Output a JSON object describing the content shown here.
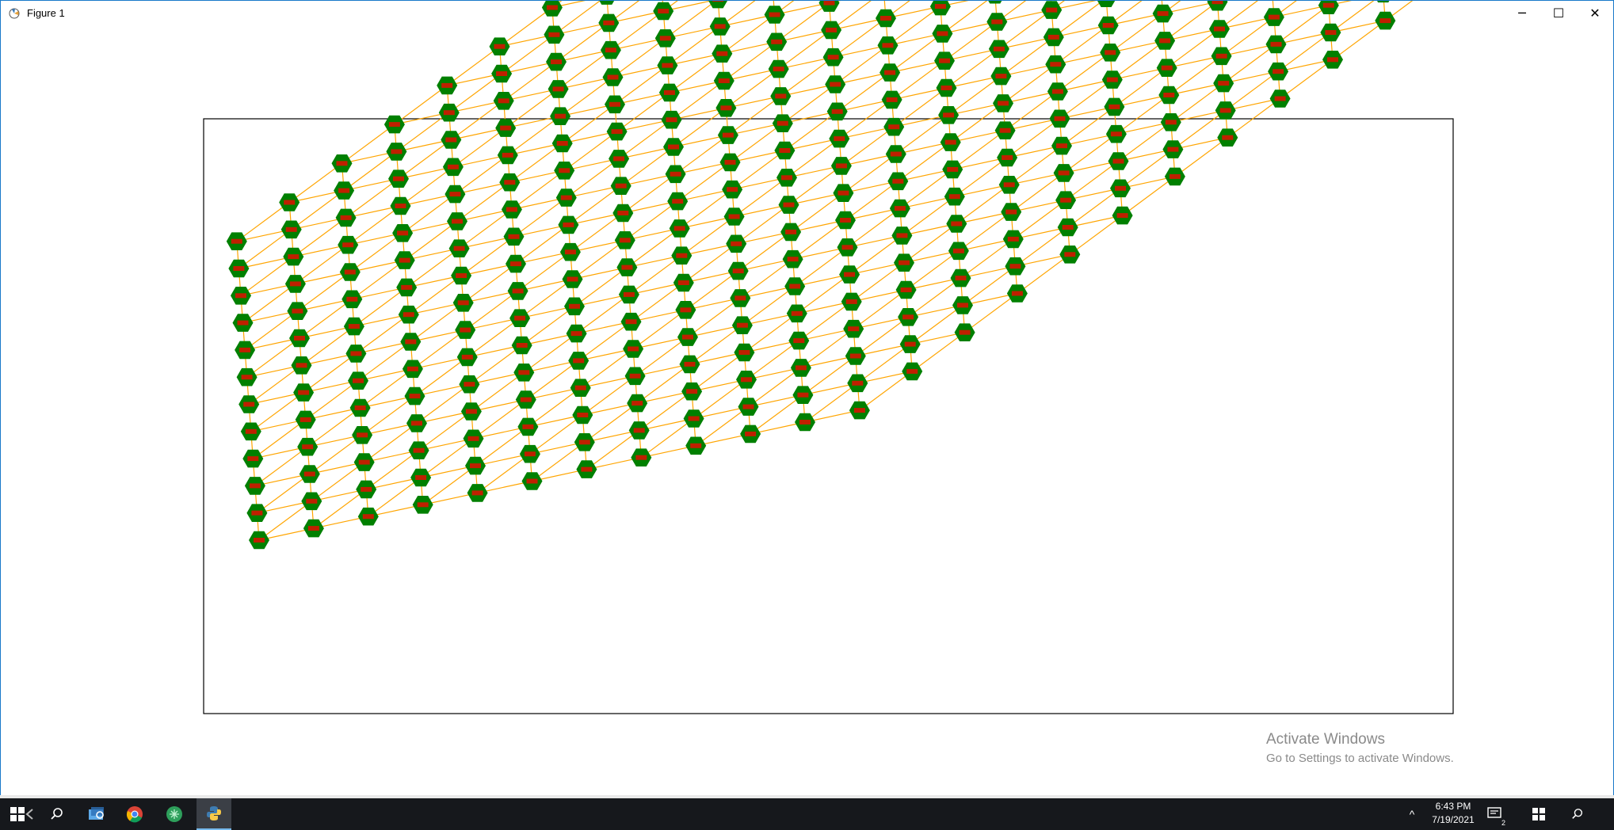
{
  "window": {
    "title": "Figure 1",
    "minimize_glyph": "─",
    "maximize_glyph": "☐",
    "close_glyph": "✕",
    "app_icon": "matplotlib-figure-icon"
  },
  "graph": {
    "node_color": "#008000",
    "label_color": "#ff0000",
    "edge_color": "#ffa500",
    "node_shape": "hexagon",
    "layout": "hexagonal lattice, 24 columns",
    "frame": "axes frame (no ticks)"
  },
  "watermark": {
    "title": "Activate Windows",
    "subtitle": "Go to Settings to activate Windows."
  },
  "taskbar": {
    "apps": [
      {
        "name": "start-button",
        "icon": "windows-logo-icon"
      },
      {
        "name": "back",
        "icon": "arrow-left-icon"
      },
      {
        "name": "search",
        "icon": "search-icon"
      },
      {
        "name": "task-view",
        "icon": "task-view-icon"
      },
      {
        "name": "chrome",
        "icon": "chrome-icon"
      },
      {
        "name": "app-green",
        "icon": "green-app-icon"
      },
      {
        "name": "python",
        "icon": "python-icon",
        "active": true
      }
    ],
    "time": "6:43 PM",
    "date": "7/19/2021",
    "notification_count": "2",
    "tray_hidden_icons": "^"
  }
}
